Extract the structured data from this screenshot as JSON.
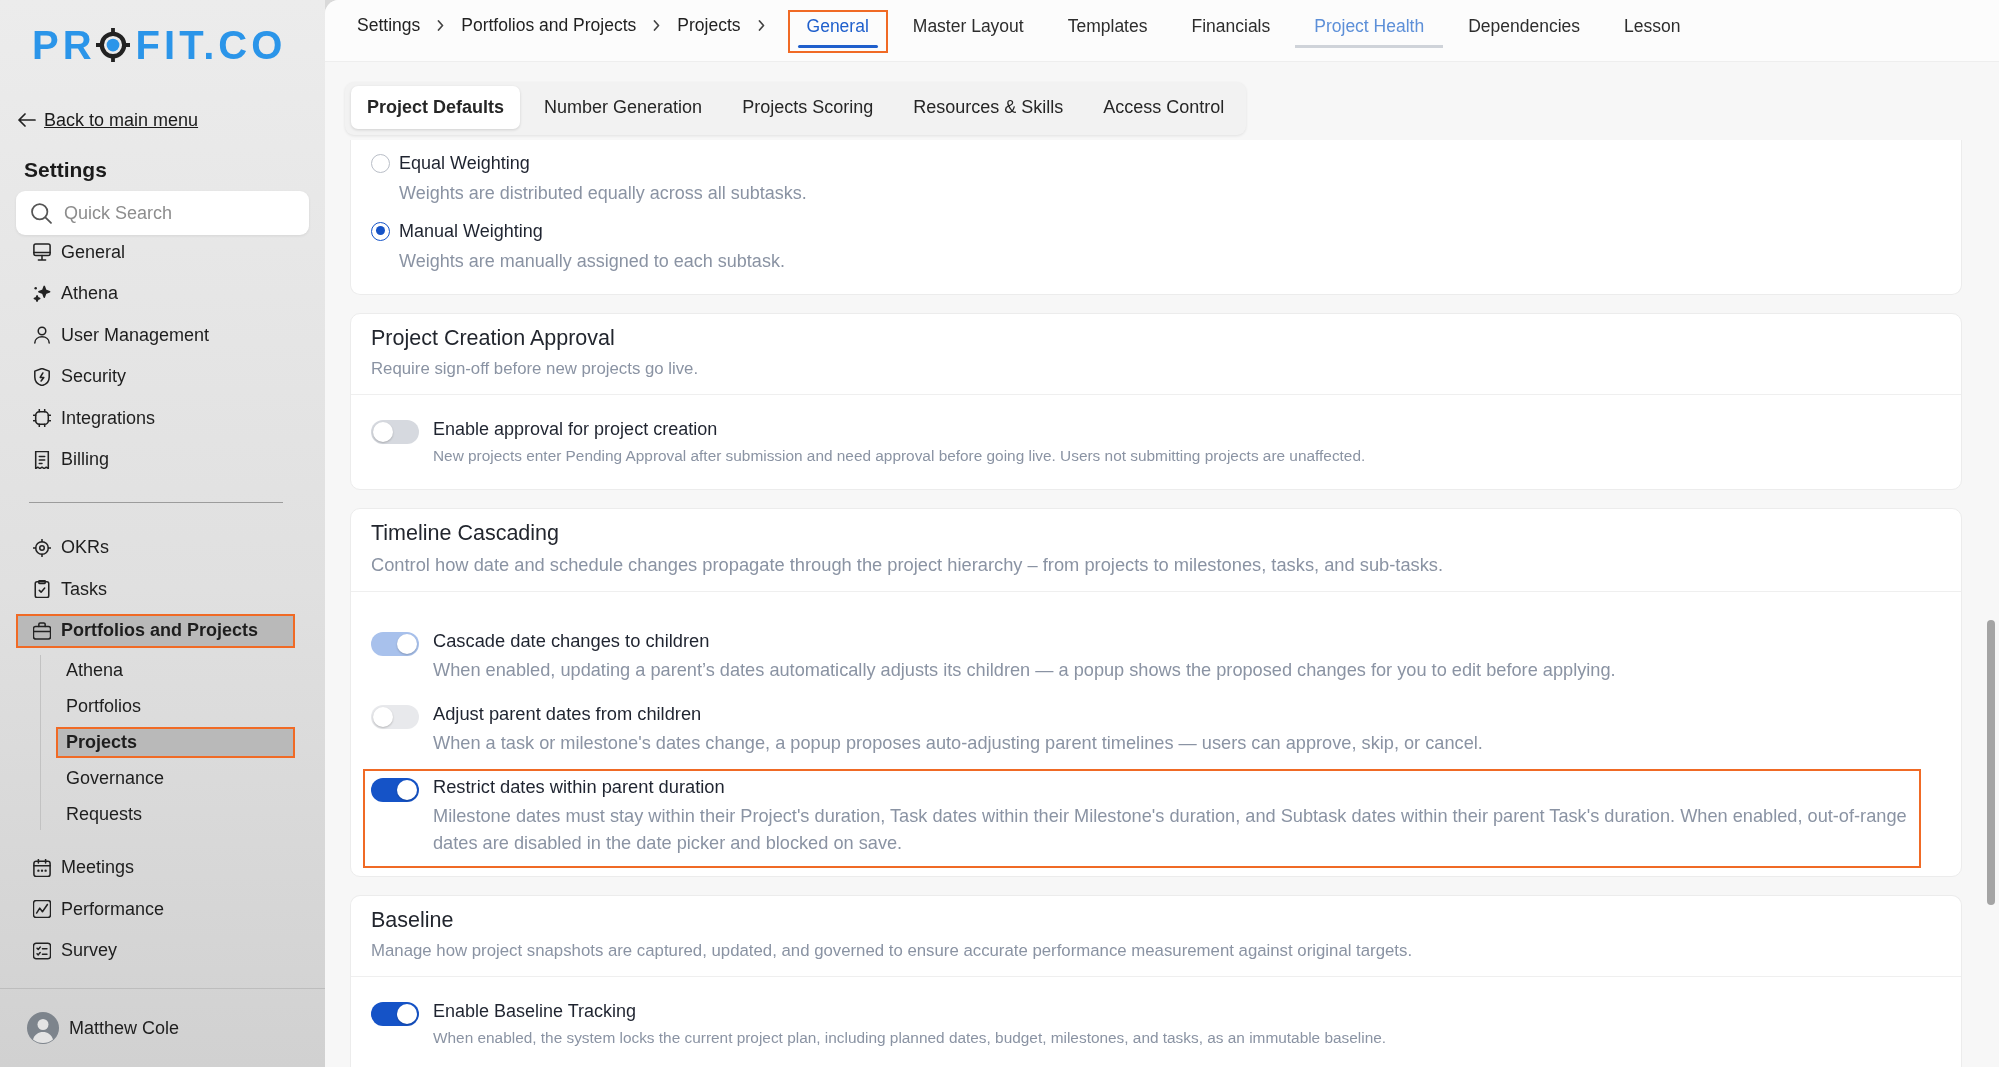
{
  "logo": {
    "left": "PR",
    "right": "FIT.CO"
  },
  "back_link": "Back to main menu",
  "sidebar": {
    "title": "Settings",
    "search": {
      "placeholder": "Quick Search"
    },
    "sections": [
      {
        "items": [
          {
            "label": "General",
            "selected": false,
            "highlighted": false
          },
          {
            "label": "Athena",
            "selected": false,
            "highlighted": false
          },
          {
            "label": "User Management",
            "selected": false,
            "highlighted": false
          },
          {
            "label": "Security",
            "selected": false,
            "highlighted": false
          },
          {
            "label": "Integrations",
            "selected": false,
            "highlighted": false
          },
          {
            "label": "Billing",
            "selected": false,
            "highlighted": false
          }
        ]
      },
      {
        "items": [
          {
            "label": "OKRs",
            "selected": false,
            "highlighted": false
          },
          {
            "label": "Tasks",
            "selected": false,
            "highlighted": false
          },
          {
            "label": "Portfolios and Projects",
            "selected": true,
            "highlighted": true,
            "children": [
              {
                "label": "Athena",
                "selected": false,
                "highlighted": false
              },
              {
                "label": "Portfolios",
                "selected": false,
                "highlighted": false
              },
              {
                "label": "Projects",
                "selected": true,
                "highlighted": true
              },
              {
                "label": "Governance",
                "selected": false,
                "highlighted": false
              },
              {
                "label": "Requests",
                "selected": false,
                "highlighted": false
              }
            ]
          },
          {
            "label": "Meetings",
            "selected": false,
            "highlighted": false
          },
          {
            "label": "Performance",
            "selected": false,
            "highlighted": false
          },
          {
            "label": "Survey",
            "selected": false,
            "highlighted": false
          }
        ]
      }
    ]
  },
  "user": {
    "name": "Matthew Cole"
  },
  "breadcrumb": [
    "Settings",
    "Portfolios and Projects",
    "Projects"
  ],
  "tabs": [
    {
      "label": "General",
      "selected": true,
      "highlighted": true,
      "hovered": false
    },
    {
      "label": "Master Layout",
      "selected": false,
      "highlighted": false,
      "hovered": false
    },
    {
      "label": "Templates",
      "selected": false,
      "highlighted": false,
      "hovered": false
    },
    {
      "label": "Financials",
      "selected": false,
      "highlighted": false,
      "hovered": false
    },
    {
      "label": "Project Health",
      "selected": false,
      "highlighted": false,
      "hovered": true
    },
    {
      "label": "Dependencies",
      "selected": false,
      "highlighted": false,
      "hovered": false
    },
    {
      "label": "Lesson",
      "selected": false,
      "highlighted": false,
      "hovered": false
    }
  ],
  "sub_tabs": [
    {
      "label": "Project Defaults",
      "selected": true
    },
    {
      "label": "Number Generation",
      "selected": false
    },
    {
      "label": "Projects Scoring",
      "selected": false
    },
    {
      "label": "Resources & Skills",
      "selected": false
    },
    {
      "label": "Access Control",
      "selected": false
    }
  ],
  "cards": [
    {
      "kind": "radios",
      "options": [
        {
          "label": "Equal Weighting",
          "description": "Weights are distributed equally across all subtasks.",
          "selected": false
        },
        {
          "label": "Manual Weighting",
          "description": "Weights are manually assigned to each subtask.",
          "selected": true
        }
      ]
    },
    {
      "kind": "toggles",
      "title": "Project Creation Approval",
      "subtitle": "Require sign-off before new projects go live.",
      "settings": [
        {
          "label": "Enable approval for project creation",
          "description": "New projects enter Pending Approval after submission and need approval before going live. Users not submitting projects are unaffected.",
          "on": false,
          "disabled": false,
          "highlighted": false
        }
      ]
    },
    {
      "kind": "spacious",
      "title": "Timeline Cascading",
      "subtitle": "Control how date and schedule changes propagate through the project hierarchy – from projects to milestones, tasks, and sub-tasks.",
      "settings": [
        {
          "label": "Cascade date changes to children",
          "description": "When enabled, updating a parent’s dates automatically adjusts its children — a popup shows the proposed changes for you to edit before applying.",
          "on": true,
          "disabled": true,
          "highlighted": false
        },
        {
          "label": "Adjust parent dates from children",
          "description": "When a task or milestone's dates change, a popup proposes auto-adjusting parent timelines — users can approve, skip, or cancel.",
          "on": false,
          "disabled": true,
          "highlighted": false
        },
        {
          "label": "Restrict dates within parent duration",
          "description": "Milestone dates must stay within their Project's duration, Task dates within their Milestone's duration, and Subtask dates within their parent Task's duration. When enabled, out-of-range dates are disabled in the date picker and blocked on save.",
          "on": true,
          "disabled": false,
          "highlighted": true
        }
      ]
    },
    {
      "kind": "toggles",
      "title": "Baseline",
      "subtitle": "Manage how project snapshots are captured, updated, and governed to ensure accurate performance measurement against original targets.",
      "settings": [
        {
          "label": "Enable Baseline Tracking",
          "description": "When enabled, the system locks the current project plan, including planned dates, budget, milestones, and tasks, as an immutable baseline.",
          "on": true,
          "disabled": false,
          "highlighted": false
        }
      ]
    }
  ]
}
